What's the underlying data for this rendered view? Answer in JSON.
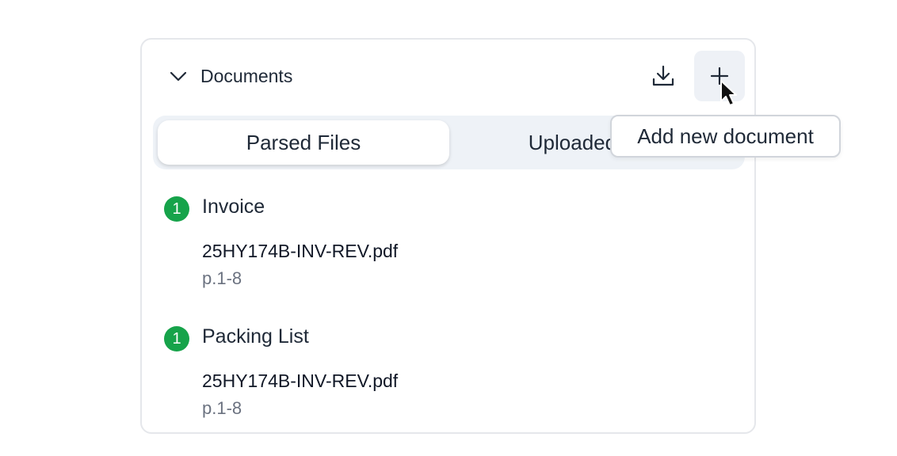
{
  "panel": {
    "title": "Documents",
    "collapse_icon": "chevron-down-icon",
    "download_icon": "download-icon",
    "add_icon": "plus-icon"
  },
  "tabs": [
    {
      "label": "Parsed Files",
      "active": true
    },
    {
      "label": "Uploaded Files",
      "active": false
    }
  ],
  "tooltip": {
    "text": "Add new document"
  },
  "documents": [
    {
      "badge": "1",
      "type": "Invoice",
      "file": "25HY174B-INV-REV.pdf",
      "pages": "p.1-8"
    },
    {
      "badge": "1",
      "type": "Packing List",
      "file": "25HY174B-INV-REV.pdf",
      "pages": "p.1-8"
    }
  ],
  "colors": {
    "badge": "#16a34a",
    "tabs_bg": "#eef2f7",
    "add_button_bg": "#eef1f6"
  }
}
